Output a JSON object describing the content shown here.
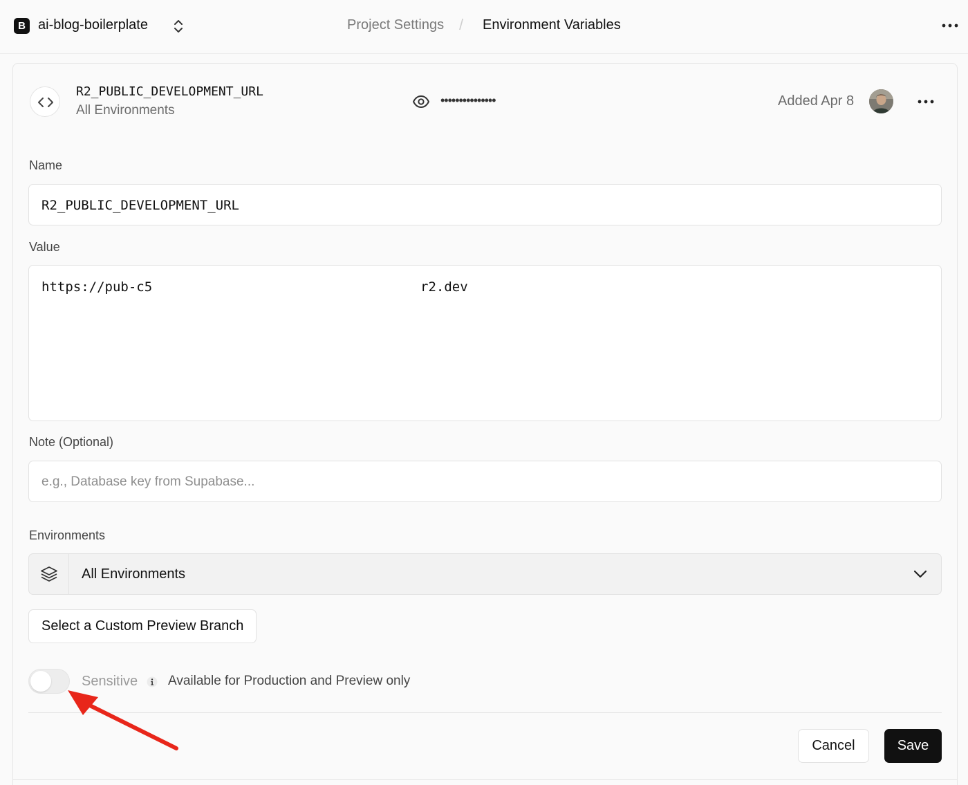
{
  "topbar": {
    "logo_letter": "B",
    "project_name": "ai-blog-boilerplate",
    "breadcrumb": [
      "Project Settings",
      "Environment Variables"
    ],
    "breadcrumb_separator": "/"
  },
  "variable": {
    "key": "R2_PUBLIC_DEVELOPMENT_URL",
    "environment": "All Environments",
    "masked_value": "•••••••••••••••",
    "added": "Added Apr 8"
  },
  "form": {
    "name_label": "Name",
    "name_value": "R2_PUBLIC_DEVELOPMENT_URL",
    "value_label": "Value",
    "value_prefix": "https://pub-c5",
    "value_suffix": "r2.dev",
    "note_label": "Note (Optional)",
    "note_placeholder": "e.g., Database key from Supabase...",
    "environments_label": "Environments",
    "environments_selected": "All Environments",
    "custom_branch_button": "Select a Custom Preview Branch",
    "sensitive_label": "Sensitive",
    "sensitive_enabled": false,
    "sensitive_description": "Available for Production and Preview only",
    "cancel_label": "Cancel",
    "save_label": "Save"
  },
  "icons": {
    "project_switch": "chevron-up-down-icon",
    "more": "ellipsis-icon",
    "code": "code-icon",
    "reveal": "eye-icon",
    "environments": "layers-icon",
    "dropdown": "chevron-down-icon",
    "info": "info-icon",
    "annotation": "red-arrow"
  },
  "colors": {
    "primary_button": "#111111",
    "annotation_arrow": "#e8261a"
  }
}
